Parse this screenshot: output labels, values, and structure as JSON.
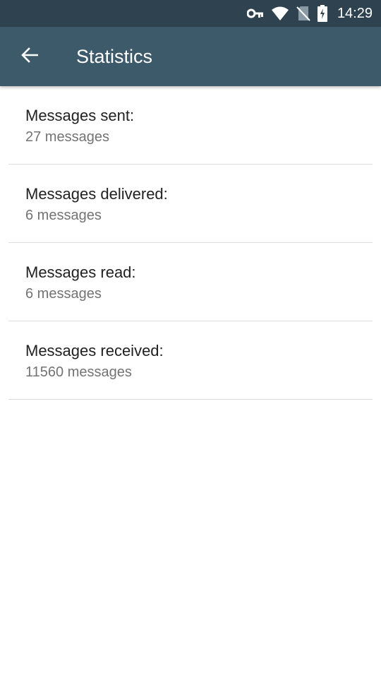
{
  "status_bar": {
    "time": "14:29",
    "icons": [
      "vpn-key-icon",
      "wifi-icon",
      "no-sim-icon",
      "battery-charging-icon"
    ]
  },
  "app_bar": {
    "back_icon": "arrow-back-icon",
    "title": "Statistics"
  },
  "stats": [
    {
      "label": "Messages sent:",
      "value": "27 messages"
    },
    {
      "label": "Messages delivered:",
      "value": "6 messages"
    },
    {
      "label": "Messages read:",
      "value": "6 messages"
    },
    {
      "label": "Messages received:",
      "value": "11560 messages"
    }
  ],
  "colors": {
    "status_bar": "#2e4250",
    "app_bar": "#3d5a6b",
    "primary_text": "#212121",
    "secondary_text": "#737373",
    "divider": "#dddddd"
  }
}
